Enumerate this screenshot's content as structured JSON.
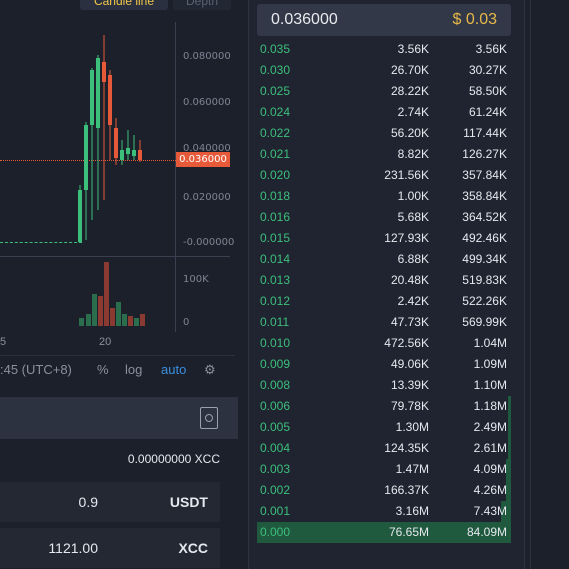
{
  "chart": {
    "tabs": {
      "candle": "Candle line",
      "depth": "Depth"
    },
    "y_labels": [
      "0.080000",
      "0.060000",
      "0.040000",
      "0.020000",
      "-0.000000"
    ],
    "current_price_tag": "0.036000",
    "volume_labels": [
      "100K",
      "0"
    ],
    "x_labels": [
      "5",
      "20"
    ],
    "colors": {
      "up": "#3dbf7c",
      "down": "#e65a3a"
    }
  },
  "toolbar": {
    "time": ":45 (UTC+8)",
    "percent": "%",
    "log": "log",
    "auto": "auto"
  },
  "trade_panel": {
    "balance": "0.00000000 XCC",
    "price_value": "0.9",
    "price_unit": "USDT",
    "amount_value": "1121.00",
    "amount_unit": "XCC"
  },
  "orderbook": {
    "last_price": "0.036000",
    "last_price_usd": "$ 0.03",
    "rows": [
      {
        "price": "0.035",
        "amount": "3.56K",
        "total": "3.56K",
        "depth": 0.0
      },
      {
        "price": "0.030",
        "amount": "26.70K",
        "total": "30.27K",
        "depth": 0.0
      },
      {
        "price": "0.025",
        "amount": "28.22K",
        "total": "58.50K",
        "depth": 0.0
      },
      {
        "price": "0.024",
        "amount": "2.74K",
        "total": "61.24K",
        "depth": 0.0
      },
      {
        "price": "0.022",
        "amount": "56.20K",
        "total": "117.44K",
        "depth": 0.0
      },
      {
        "price": "0.021",
        "amount": "8.82K",
        "total": "126.27K",
        "depth": 0.0
      },
      {
        "price": "0.020",
        "amount": "231.56K",
        "total": "357.84K",
        "depth": 0.0
      },
      {
        "price": "0.018",
        "amount": "1.00K",
        "total": "358.84K",
        "depth": 0.0
      },
      {
        "price": "0.016",
        "amount": "5.68K",
        "total": "364.52K",
        "depth": 0.0
      },
      {
        "price": "0.015",
        "amount": "127.93K",
        "total": "492.46K",
        "depth": 0.0
      },
      {
        "price": "0.014",
        "amount": "6.88K",
        "total": "499.34K",
        "depth": 0.0
      },
      {
        "price": "0.013",
        "amount": "20.48K",
        "total": "519.83K",
        "depth": 0.0
      },
      {
        "price": "0.012",
        "amount": "2.42K",
        "total": "522.26K",
        "depth": 0.0
      },
      {
        "price": "0.011",
        "amount": "47.73K",
        "total": "569.99K",
        "depth": 0.0
      },
      {
        "price": "0.010",
        "amount": "472.56K",
        "total": "1.04M",
        "depth": 0.0
      },
      {
        "price": "0.009",
        "amount": "49.06K",
        "total": "1.09M",
        "depth": 0.0
      },
      {
        "price": "0.008",
        "amount": "13.39K",
        "total": "1.10M",
        "depth": 0.0
      },
      {
        "price": "0.006",
        "amount": "79.78K",
        "total": "1.18M",
        "depth": 0.01
      },
      {
        "price": "0.005",
        "amount": "1.30M",
        "total": "2.49M",
        "depth": 0.01
      },
      {
        "price": "0.004",
        "amount": "124.35K",
        "total": "2.61M",
        "depth": 0.01
      },
      {
        "price": "0.003",
        "amount": "1.47M",
        "total": "4.09M",
        "depth": 0.02
      },
      {
        "price": "0.002",
        "amount": "166.37K",
        "total": "4.26M",
        "depth": 0.02
      },
      {
        "price": "0.001",
        "amount": "3.16M",
        "total": "7.43M",
        "depth": 0.04
      },
      {
        "price": "0.000",
        "amount": "76.65M",
        "total": "84.09M",
        "depth": 1.0
      }
    ]
  }
}
